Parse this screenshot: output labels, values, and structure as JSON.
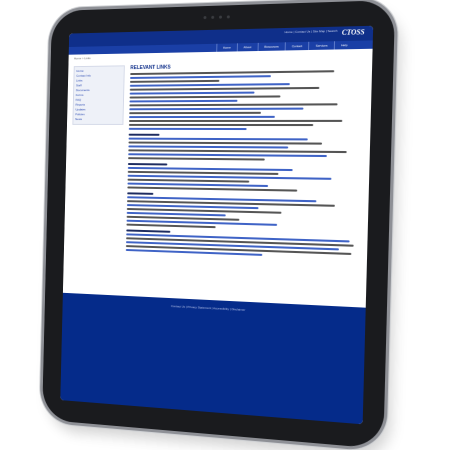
{
  "device": {
    "cameras": [
      "dot",
      "dot",
      "dot",
      "dot"
    ]
  },
  "site": {
    "logo": "CTOSS",
    "utility_text": "Home | Contact Us | Site Map | Search",
    "nav": [
      "Home",
      "About",
      "Resources",
      "Contact",
      "Services",
      "Help"
    ],
    "breadcrumb": "Home > Links",
    "sidebar_links": [
      "Home",
      "Contact Info",
      "Links",
      "Staff",
      "Documents",
      "Forms",
      "FAQ",
      "Reports",
      "Updates",
      "Policies",
      "News"
    ],
    "page_title": "RELEVANT LINKS",
    "footer": "Contact Us | Privacy Statement | Accessibility | Disclaimer"
  }
}
